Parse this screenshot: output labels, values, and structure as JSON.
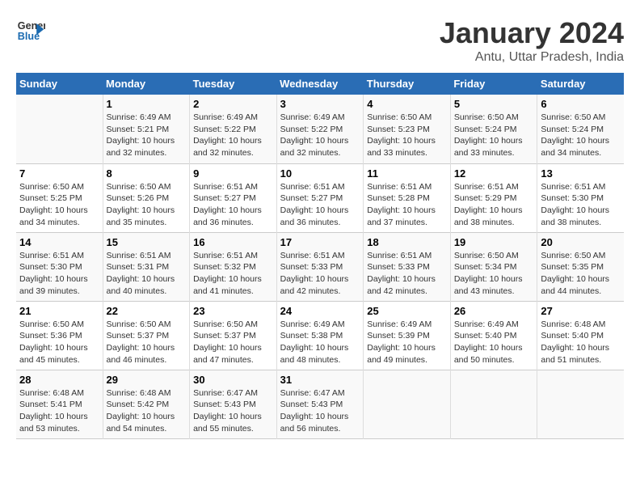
{
  "logo": {
    "line1": "General",
    "line2": "Blue"
  },
  "title": "January 2024",
  "subtitle": "Antu, Uttar Pradesh, India",
  "days_of_week": [
    "Sunday",
    "Monday",
    "Tuesday",
    "Wednesday",
    "Thursday",
    "Friday",
    "Saturday"
  ],
  "weeks": [
    [
      {
        "day": "",
        "info": ""
      },
      {
        "day": "1",
        "info": "Sunrise: 6:49 AM\nSunset: 5:21 PM\nDaylight: 10 hours\nand 32 minutes."
      },
      {
        "day": "2",
        "info": "Sunrise: 6:49 AM\nSunset: 5:22 PM\nDaylight: 10 hours\nand 32 minutes."
      },
      {
        "day": "3",
        "info": "Sunrise: 6:49 AM\nSunset: 5:22 PM\nDaylight: 10 hours\nand 32 minutes."
      },
      {
        "day": "4",
        "info": "Sunrise: 6:50 AM\nSunset: 5:23 PM\nDaylight: 10 hours\nand 33 minutes."
      },
      {
        "day": "5",
        "info": "Sunrise: 6:50 AM\nSunset: 5:24 PM\nDaylight: 10 hours\nand 33 minutes."
      },
      {
        "day": "6",
        "info": "Sunrise: 6:50 AM\nSunset: 5:24 PM\nDaylight: 10 hours\nand 34 minutes."
      }
    ],
    [
      {
        "day": "7",
        "info": "Sunrise: 6:50 AM\nSunset: 5:25 PM\nDaylight: 10 hours\nand 34 minutes."
      },
      {
        "day": "8",
        "info": "Sunrise: 6:50 AM\nSunset: 5:26 PM\nDaylight: 10 hours\nand 35 minutes."
      },
      {
        "day": "9",
        "info": "Sunrise: 6:51 AM\nSunset: 5:27 PM\nDaylight: 10 hours\nand 36 minutes."
      },
      {
        "day": "10",
        "info": "Sunrise: 6:51 AM\nSunset: 5:27 PM\nDaylight: 10 hours\nand 36 minutes."
      },
      {
        "day": "11",
        "info": "Sunrise: 6:51 AM\nSunset: 5:28 PM\nDaylight: 10 hours\nand 37 minutes."
      },
      {
        "day": "12",
        "info": "Sunrise: 6:51 AM\nSunset: 5:29 PM\nDaylight: 10 hours\nand 38 minutes."
      },
      {
        "day": "13",
        "info": "Sunrise: 6:51 AM\nSunset: 5:30 PM\nDaylight: 10 hours\nand 38 minutes."
      }
    ],
    [
      {
        "day": "14",
        "info": "Sunrise: 6:51 AM\nSunset: 5:30 PM\nDaylight: 10 hours\nand 39 minutes."
      },
      {
        "day": "15",
        "info": "Sunrise: 6:51 AM\nSunset: 5:31 PM\nDaylight: 10 hours\nand 40 minutes."
      },
      {
        "day": "16",
        "info": "Sunrise: 6:51 AM\nSunset: 5:32 PM\nDaylight: 10 hours\nand 41 minutes."
      },
      {
        "day": "17",
        "info": "Sunrise: 6:51 AM\nSunset: 5:33 PM\nDaylight: 10 hours\nand 42 minutes."
      },
      {
        "day": "18",
        "info": "Sunrise: 6:51 AM\nSunset: 5:33 PM\nDaylight: 10 hours\nand 42 minutes."
      },
      {
        "day": "19",
        "info": "Sunrise: 6:50 AM\nSunset: 5:34 PM\nDaylight: 10 hours\nand 43 minutes."
      },
      {
        "day": "20",
        "info": "Sunrise: 6:50 AM\nSunset: 5:35 PM\nDaylight: 10 hours\nand 44 minutes."
      }
    ],
    [
      {
        "day": "21",
        "info": "Sunrise: 6:50 AM\nSunset: 5:36 PM\nDaylight: 10 hours\nand 45 minutes."
      },
      {
        "day": "22",
        "info": "Sunrise: 6:50 AM\nSunset: 5:37 PM\nDaylight: 10 hours\nand 46 minutes."
      },
      {
        "day": "23",
        "info": "Sunrise: 6:50 AM\nSunset: 5:37 PM\nDaylight: 10 hours\nand 47 minutes."
      },
      {
        "day": "24",
        "info": "Sunrise: 6:49 AM\nSunset: 5:38 PM\nDaylight: 10 hours\nand 48 minutes."
      },
      {
        "day": "25",
        "info": "Sunrise: 6:49 AM\nSunset: 5:39 PM\nDaylight: 10 hours\nand 49 minutes."
      },
      {
        "day": "26",
        "info": "Sunrise: 6:49 AM\nSunset: 5:40 PM\nDaylight: 10 hours\nand 50 minutes."
      },
      {
        "day": "27",
        "info": "Sunrise: 6:48 AM\nSunset: 5:40 PM\nDaylight: 10 hours\nand 51 minutes."
      }
    ],
    [
      {
        "day": "28",
        "info": "Sunrise: 6:48 AM\nSunset: 5:41 PM\nDaylight: 10 hours\nand 53 minutes."
      },
      {
        "day": "29",
        "info": "Sunrise: 6:48 AM\nSunset: 5:42 PM\nDaylight: 10 hours\nand 54 minutes."
      },
      {
        "day": "30",
        "info": "Sunrise: 6:47 AM\nSunset: 5:43 PM\nDaylight: 10 hours\nand 55 minutes."
      },
      {
        "day": "31",
        "info": "Sunrise: 6:47 AM\nSunset: 5:43 PM\nDaylight: 10 hours\nand 56 minutes."
      },
      {
        "day": "",
        "info": ""
      },
      {
        "day": "",
        "info": ""
      },
      {
        "day": "",
        "info": ""
      }
    ]
  ]
}
